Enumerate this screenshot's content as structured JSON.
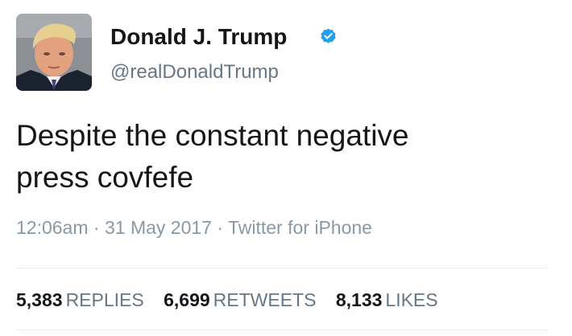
{
  "user": {
    "display_name": "Donald J. Trump",
    "handle": "@realDonaldTrump",
    "verified": true,
    "verified_icon": "verified-badge-icon",
    "avatar_icon": "avatar-photo"
  },
  "tweet": {
    "line1": "Despite the constant negative",
    "line2": "press covfefe"
  },
  "meta": {
    "time": "12:06am",
    "sep1": " · ",
    "date": "31 May 2017",
    "sep2": " · ",
    "source": "Twitter for iPhone"
  },
  "stats": {
    "replies_count": "5,383",
    "replies_label": "REPLIES",
    "retweets_count": "6,699",
    "retweets_label": "RETWEETS",
    "likes_count": "8,133",
    "likes_label": "LIKES"
  },
  "colors": {
    "verified_blue": "#1da1f2",
    "text_primary": "#14171a",
    "text_secondary": "#657786",
    "text_muted": "#8899a6",
    "divider": "#e6ecf0"
  }
}
